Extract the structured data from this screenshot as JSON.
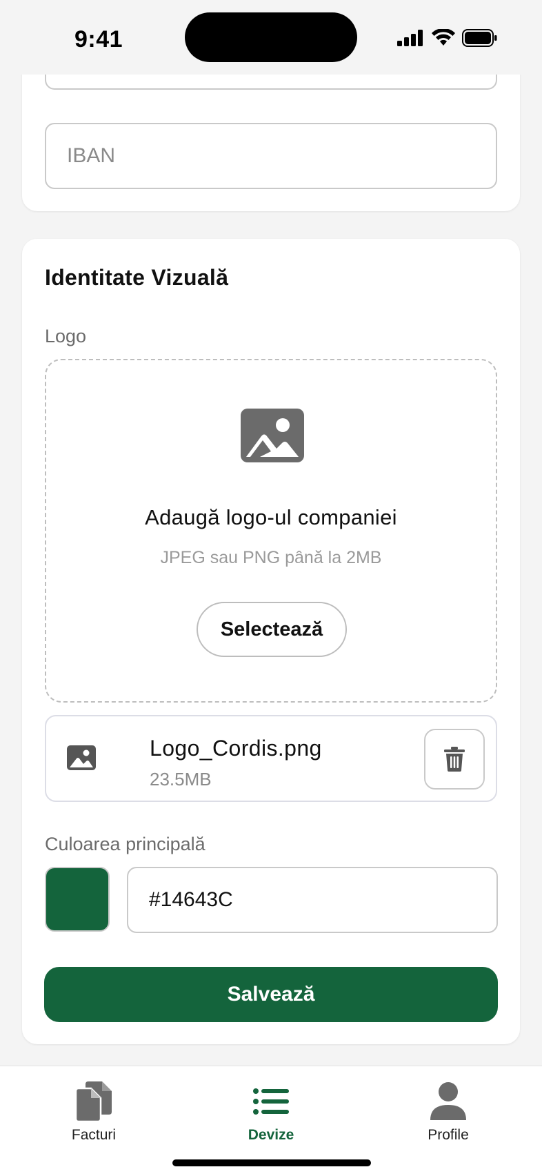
{
  "status_bar": {
    "time": "9:41"
  },
  "bank_card": {
    "iban_placeholder": "IBAN"
  },
  "visual_identity": {
    "title": "Identitate Vizuală",
    "logo_label": "Logo",
    "dropzone": {
      "icon": "image-icon",
      "title": "Adaugă logo-ul companiei",
      "hint": "JPEG sau PNG până la 2MB",
      "select_label": "Selectează"
    },
    "file": {
      "icon": "image-icon",
      "name": "Logo_Cordis.png",
      "size": "23.5MB",
      "delete_icon": "trash-icon"
    },
    "color_label": "Culoarea principală",
    "color_value": "#14643C",
    "save_label": "Salvează"
  },
  "tabs": [
    {
      "label": "Facturi",
      "icon": "documents-icon",
      "active": false
    },
    {
      "label": "Devize",
      "icon": "list-icon",
      "active": true
    },
    {
      "label": "Profile",
      "icon": "person-icon",
      "active": false
    }
  ],
  "colors": {
    "accent": "#14643C",
    "inactive_icon": "#6b6b6b"
  }
}
